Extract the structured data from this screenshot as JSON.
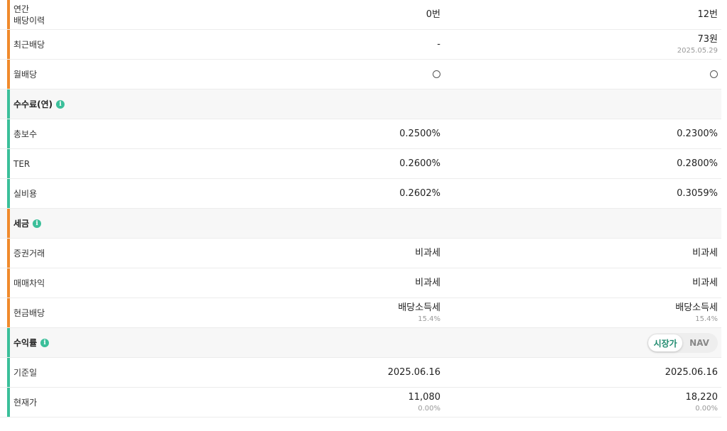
{
  "colors": {
    "orange_bar": "#f08a2c",
    "green_bar": "#3bbf9a",
    "toggle_active": "#1f8a6e"
  },
  "rows": {
    "annual_dividend_history": {
      "label_line1": "연간",
      "label_line2": "배당이력",
      "col1": "0번",
      "col2": "12번"
    },
    "recent_dividend": {
      "label": "최근배당",
      "col1": "-",
      "col2": "73원",
      "col2_sub": "2025.05.29"
    },
    "monthly_dividend": {
      "label": "월배당",
      "col1_icon": "circle-icon",
      "col2_icon": "circle-icon"
    },
    "fees_section": {
      "label": "수수료(연)",
      "icon": "info-icon"
    },
    "total_fee": {
      "label": "총보수",
      "col1": "0.2500%",
      "col2": "0.2300%"
    },
    "ter": {
      "label": "TER",
      "col1": "0.2600%",
      "col2": "0.2800%"
    },
    "actual_cost": {
      "label": "실비용",
      "col1": "0.2602%",
      "col2": "0.3059%"
    },
    "tax_section": {
      "label": "세금",
      "icon": "info-icon"
    },
    "securities_trading": {
      "label": "증권거래",
      "col1": "비과세",
      "col2": "비과세"
    },
    "trading_gain": {
      "label": "매매차익",
      "col1": "비과세",
      "col2": "비과세"
    },
    "cash_dividend": {
      "label": "현금배당",
      "col1": "배당소득세",
      "col1_sub": "15.4%",
      "col2": "배당소득세",
      "col2_sub": "15.4%"
    },
    "return_section": {
      "label": "수익률",
      "icon": "info-icon",
      "toggle_market": "시장가",
      "toggle_nav": "NAV",
      "selected": "시장가"
    },
    "base_date": {
      "label": "기준일",
      "col1": "2025.06.16",
      "col2": "2025.06.16"
    },
    "current_price": {
      "label": "현재가",
      "col1": "11,080",
      "col1_sub": "0.00%",
      "col2": "18,220",
      "col2_sub": "0.00%"
    }
  }
}
